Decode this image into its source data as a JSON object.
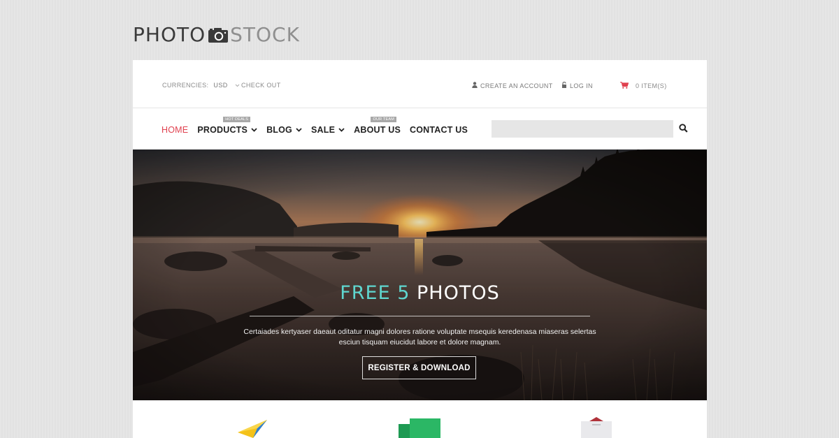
{
  "logo": {
    "part1": "PHOTO",
    "part2": "STOCK",
    "icon": "camera-icon"
  },
  "topbar": {
    "currency_label": "CURRENCIES:",
    "currency_value": "USD",
    "checkout": "CHECK OUT",
    "create_account": "CREATE AN ACCOUNT",
    "login": "LOG IN",
    "cart": "0 ITEM(S)",
    "cart_color": "#e0414f"
  },
  "nav": {
    "home": "HOME",
    "products": "PRODUCTS",
    "products_tag": "HOT DEALS",
    "blog": "BLOG",
    "sale": "SALE",
    "about": "ABOUT US",
    "about_tag": "OUR TEAM",
    "contact": "CONTACT US",
    "active_color": "#e0414f"
  },
  "search": {
    "placeholder": ""
  },
  "hero": {
    "title_accent": "FREE 5",
    "title_rest": "PHOTOS",
    "accent_color": "#5fd6cf",
    "description": "Certaiades kertyaser daeaut oditatur magni dolores ratione voluptate msequis keredenasa miaseras selertas esciun tisquam eiucidut labore et dolore magnam.",
    "button": "REGISTER & DOWNLOAD"
  },
  "features": [
    {
      "icon": "paper-plane-icon"
    },
    {
      "icon": "documents-icon"
    },
    {
      "icon": "envelope-icon"
    }
  ]
}
